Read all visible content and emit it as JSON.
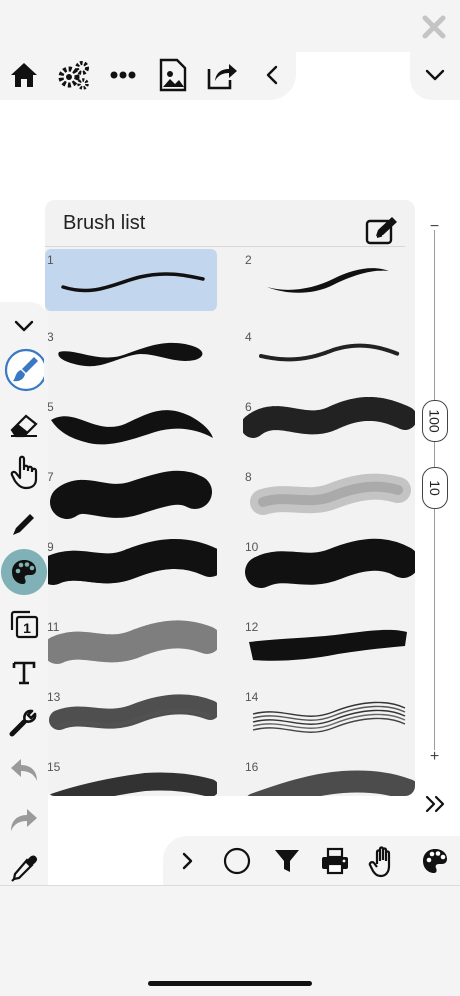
{
  "panel": {
    "title": "Brush list",
    "brushes": [
      {
        "num": "1",
        "selected": true
      },
      {
        "num": "2"
      },
      {
        "num": "3"
      },
      {
        "num": "4"
      },
      {
        "num": "5"
      },
      {
        "num": "6"
      },
      {
        "num": "7"
      },
      {
        "num": "8"
      },
      {
        "num": "9"
      },
      {
        "num": "10"
      },
      {
        "num": "11"
      },
      {
        "num": "12"
      },
      {
        "num": "13"
      },
      {
        "num": "14"
      },
      {
        "num": "15"
      },
      {
        "num": "16"
      }
    ]
  },
  "slider": {
    "minus": "−",
    "plus": "+",
    "size_value": "100",
    "opacity_value": "10"
  },
  "top_toolbar": {
    "icons": [
      "home-icon",
      "settings-icon",
      "more-icon",
      "image-icon",
      "share-icon",
      "chevron-left-icon"
    ]
  },
  "side_toolbar": {
    "icons": [
      "chevron-down-icon",
      "brush-icon",
      "eraser-icon",
      "hand-pointer-icon",
      "pencil-icon",
      "palette-icon",
      "layer-icon",
      "text-icon",
      "wrench-icon",
      "undo-icon",
      "redo-icon",
      "eyedropper-icon"
    ],
    "layer_number": "1",
    "selected_color": "#7fb1b6"
  },
  "bottom_toolbar": {
    "icons": [
      "chevron-right-icon",
      "circle-icon",
      "filter-icon",
      "print-icon",
      "hand-icon",
      "palette-icon"
    ]
  },
  "colors": {
    "selected_brush_bg": "#c2d6ee",
    "toolbar_bg": "#f4f4f4",
    "panel_bg": "#f2f2f2"
  }
}
